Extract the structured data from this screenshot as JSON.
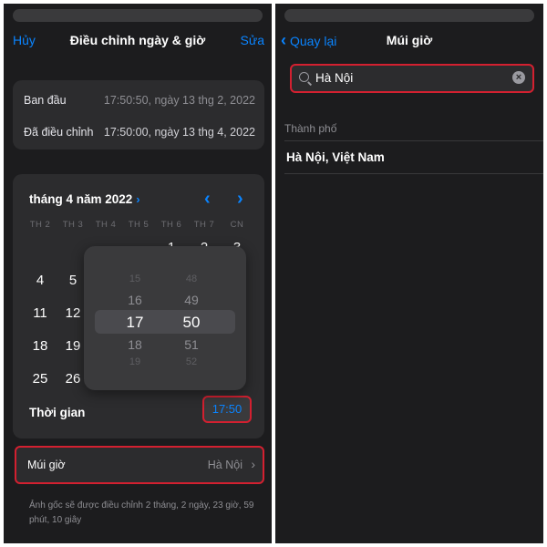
{
  "left": {
    "nav": {
      "cancel": "Hủy",
      "title": "Điều chỉnh ngày & giờ",
      "edit": "Sửa"
    },
    "original": {
      "label": "Ban đầu",
      "value": "17:50:50, ngày 13 thg 2, 2022",
      "adjusted_label": "Đã điều chỉnh",
      "adjusted_value": "17:50:00, ngày 13 thg 4, 2022"
    },
    "calendar": {
      "month_title": "tháng 4 năm 2022",
      "month_chevron": "›",
      "prev_arrow": "‹",
      "next_arrow": "›",
      "weekdays": [
        "TH 2",
        "TH 3",
        "TH 4",
        "TH 5",
        "TH 6",
        "TH 7",
        "CN"
      ],
      "days": [
        "1",
        "2",
        "3",
        "4",
        "5",
        "11",
        "12",
        "18",
        "19",
        "25",
        "26"
      ]
    },
    "time_picker": {
      "hours": [
        "15",
        "16",
        "17",
        "18",
        "19"
      ],
      "minutes": [
        "48",
        "49",
        "50",
        "51",
        "52"
      ]
    },
    "time": {
      "label": "Thời gian",
      "value": "17:50"
    },
    "timezone": {
      "label": "Múi giờ",
      "value": "Hà Nội",
      "chevron": "›"
    },
    "footnote": "Ảnh gốc sẽ được điều chỉnh 2 tháng, 2 ngày, 23 giờ, 59 phút, 10 giây"
  },
  "right": {
    "nav": {
      "back": "Quay lại",
      "back_chevron": "‹",
      "title": "Múi giờ"
    },
    "search": {
      "value": "Hà Nội",
      "clear": "×"
    },
    "section": "Thành phố",
    "results": [
      "Hà Nội, Việt Nam"
    ]
  },
  "colors": {
    "accent": "#0a84ff",
    "highlight_border": "#d32030",
    "background": "#1c1c1e",
    "card": "#2c2c2e"
  },
  "icons": [
    "chevron-left-icon",
    "chevron-right-icon",
    "search-icon",
    "clear-icon"
  ]
}
